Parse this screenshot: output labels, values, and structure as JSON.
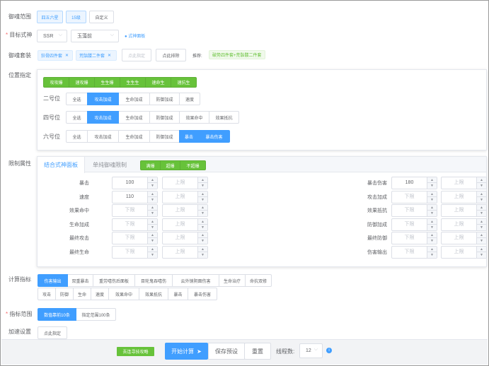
{
  "rows": {
    "rarity": {
      "label": "御魂范围",
      "options": [
        "四五六星",
        "15级",
        "自定义"
      ]
    },
    "target": {
      "label": "目标式神",
      "rarity_value": "SSR",
      "shikigami_value": "玉藻前",
      "panel_link": "式神面板"
    },
    "sets": {
      "label": "御魂套装",
      "tags": [
        "狂骨四件套",
        "荒骷髅二件套"
      ],
      "pick_placeholder": "点此指定",
      "exclude_button": "点此排除",
      "recommend_label": "推荐:",
      "recommend_tag": "破势四件套+荒骷髅二件套"
    },
    "position": {
      "label": "位置指定",
      "combo_buttons": [
        "攻攻爆",
        "速攻爆",
        "生生爆",
        "生生生",
        "速命生",
        "速抗生"
      ]
    },
    "limits": {
      "label": "限制属性"
    },
    "calc": {
      "label": "计算指标"
    },
    "metric_range": {
      "label": "指标范围"
    },
    "speedup": {
      "label": "加速设置",
      "button": "点此指定"
    }
  },
  "slots": [
    {
      "name": "二号位",
      "options": [
        "全选",
        "攻击加成",
        "生命加成",
        "防御加成",
        "速度"
      ],
      "selected": [
        "攻击加成"
      ]
    },
    {
      "name": "四号位",
      "options": [
        "全选",
        "攻击加成",
        "生命加成",
        "防御加成",
        "效果命中",
        "效果抵抗"
      ],
      "selected": [
        "攻击加成"
      ]
    },
    {
      "name": "六号位",
      "options": [
        "全选",
        "攻击加成",
        "生命加成",
        "防御加成",
        "暴击",
        "暴击伤害"
      ],
      "selected": [
        "暴击",
        "暴击伤害"
      ]
    }
  ],
  "limit_tabs": {
    "active": "结合式神面板",
    "inactive": "单纯御魂限制",
    "filter_buttons": [
      "满爆",
      "超爆",
      "不超爆"
    ]
  },
  "left_limits": [
    {
      "name": "暴击",
      "min": "100",
      "max": "上限"
    },
    {
      "name": "速度",
      "min": "110",
      "max": "上限"
    },
    {
      "name": "效果命中",
      "min": "下限",
      "max": "上限"
    },
    {
      "name": "生命加成",
      "min": "下限",
      "max": "上限"
    },
    {
      "name": "最终攻击",
      "min": "下限",
      "max": "上限"
    },
    {
      "name": "最终生命",
      "min": "下限",
      "max": "上限"
    }
  ],
  "right_limits": [
    {
      "name": "暴击伤害",
      "min": "180",
      "max": "上限"
    },
    {
      "name": "攻击加成",
      "min": "下限",
      "max": "上限"
    },
    {
      "name": "效果抵抗",
      "min": "下限",
      "max": "上限"
    },
    {
      "name": "防御加成",
      "min": "下限",
      "max": "上限"
    },
    {
      "name": "最终防御",
      "min": "下限",
      "max": "上限"
    },
    {
      "name": "伤害输出",
      "min": "下限",
      "max": "上限"
    }
  ],
  "calc_row1": [
    "伤害输出",
    "双重暴击",
    "重劳嘻伤后面板",
    "目轮鬼吞嘻伤",
    "云外镜阴面伤害",
    "生命治疗",
    "命抗双修"
  ],
  "calc_row2": [
    "攻击",
    "防御",
    "生命",
    "速度",
    "效果命中",
    "效果抵抗",
    "暴击",
    "暴击伤害"
  ],
  "range_options": [
    "数值靠前10条",
    "指定范围100条"
  ],
  "footer": {
    "promo": "吾连寻技攻略",
    "start": "开始计算",
    "save": "保存预设",
    "reset": "重置",
    "threads_label": "线程数:",
    "threads_value": "12"
  },
  "colors": {
    "primary": "#409eff",
    "green": "#67c23a"
  }
}
